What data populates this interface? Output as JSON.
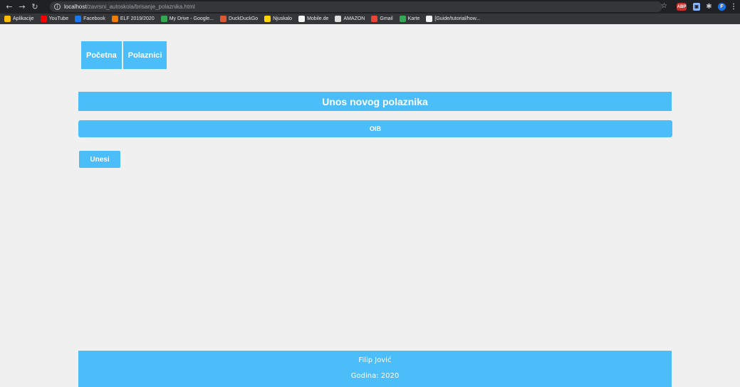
{
  "browser": {
    "url_host": "localhost",
    "url_path": "/zavrsni_autoskola/brisanje_polaznika.html",
    "avatar_letter": "F",
    "abp_label": "ABP"
  },
  "bookmarks": [
    {
      "label": "Aplikacije",
      "color": "#fbbc04"
    },
    {
      "label": "YouTube",
      "color": "#ff0000"
    },
    {
      "label": "Facebook",
      "color": "#1877f2"
    },
    {
      "label": "ELF 2019/2020",
      "color": "#f57c00"
    },
    {
      "label": "My Drive - Google...",
      "color": "#34a853"
    },
    {
      "label": "DuckDuckGo",
      "color": "#de5833"
    },
    {
      "label": "Njuskalo",
      "color": "#ffd400"
    },
    {
      "label": "Mobile.de",
      "color": "#f5f5f5"
    },
    {
      "label": "AMAZON",
      "color": "#e0e0e0"
    },
    {
      "label": "Gmail",
      "color": "#ea4335"
    },
    {
      "label": "Karte",
      "color": "#34a853"
    },
    {
      "label": "[Guide/tutorial/how...",
      "color": "#f1f3f4"
    }
  ],
  "menu": {
    "pocetna": "Početna",
    "polaznici": "Polaznici"
  },
  "form": {
    "heading": "Unos novog polaznika",
    "oib_placeholder": "OIB",
    "submit_label": "Unesi"
  },
  "footer": {
    "author": "Filip Jović",
    "year_text": "Godina: 2020"
  },
  "colors": {
    "accent": "#4bbdf9",
    "background": "#f0f0f0"
  }
}
